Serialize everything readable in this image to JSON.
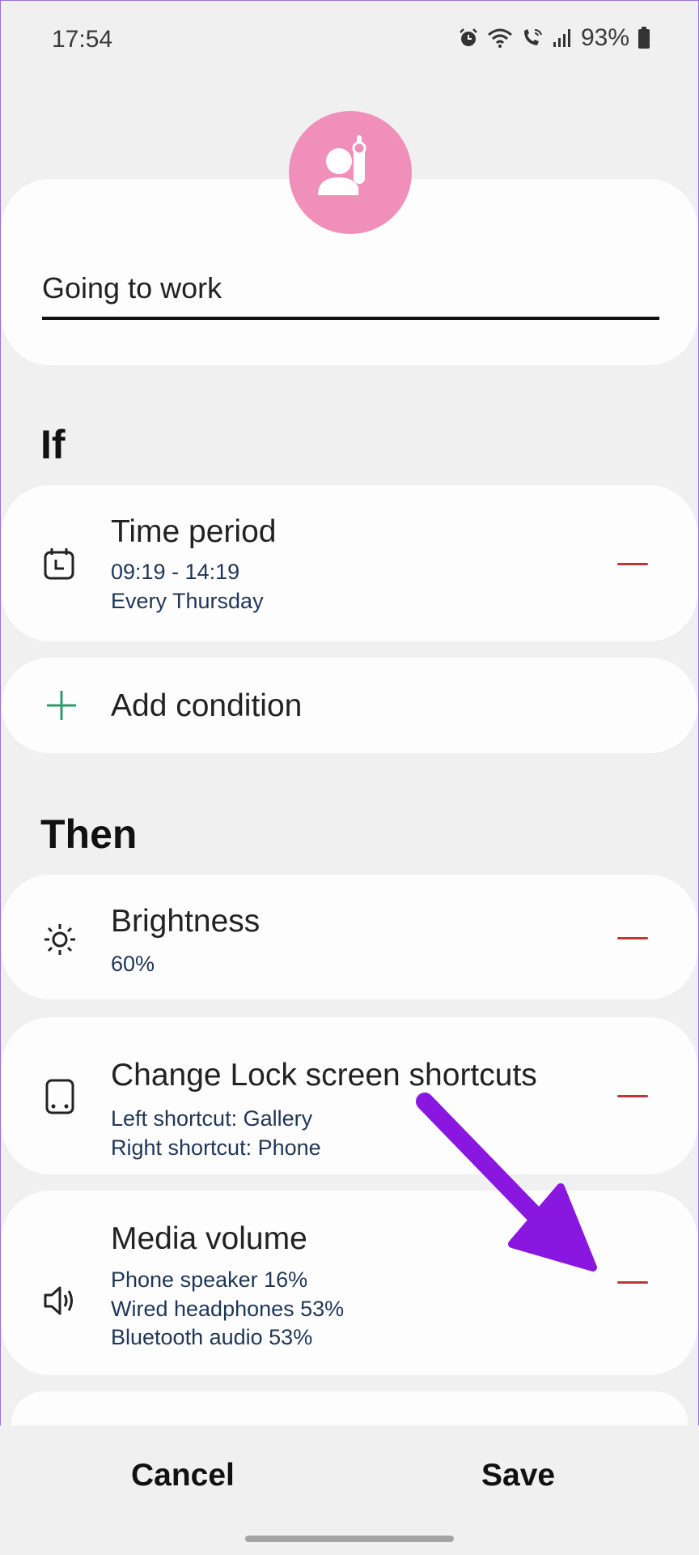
{
  "status_bar": {
    "time": "17:54",
    "battery_percent": "93%",
    "icons": [
      "alarm-icon",
      "wifi-icon",
      "wifi-call-icon",
      "signal-icon",
      "battery-icon"
    ]
  },
  "routine": {
    "icon": "person-hand-raised-icon",
    "icon_color": "#f08fba",
    "name": "Going to work"
  },
  "if_section": {
    "title": "If",
    "conditions": [
      {
        "icon": "calendar-clock-icon",
        "title": "Time period",
        "lines": [
          "09:19 - 14:19",
          "Every Thursday"
        ]
      }
    ],
    "add_label": "Add condition",
    "add_icon_color": "#2e9a6a"
  },
  "then_section": {
    "title": "Then",
    "actions": [
      {
        "icon": "brightness-icon",
        "title": "Brightness",
        "lines": [
          "60%"
        ]
      },
      {
        "icon": "phone-lockscreen-icon",
        "title": "Change Lock screen shortcuts",
        "lines": [
          "Left shortcut: Gallery",
          "Right shortcut: Phone"
        ]
      },
      {
        "icon": "speaker-volume-icon",
        "title": "Media volume",
        "lines": [
          "Phone speaker 16%",
          "Wired headphones 53%",
          "Bluetooth audio 53%"
        ]
      }
    ]
  },
  "footer": {
    "cancel_label": "Cancel",
    "save_label": "Save"
  },
  "annotation": {
    "color": "#8a17e0"
  }
}
